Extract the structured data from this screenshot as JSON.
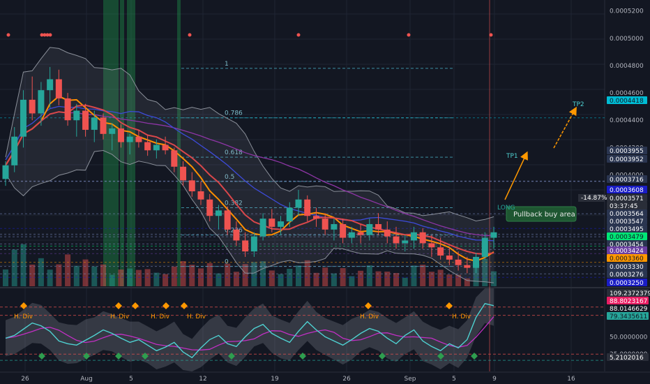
{
  "colors": {
    "background": "#131722",
    "grid": "#1f2433",
    "up": "#26a69a",
    "down": "#ef5350",
    "fib": "#4fc3d9",
    "fib_label": "#7fbfcc",
    "text": "#b2b5be",
    "ema_orange": "#ff8f00",
    "ema_red": "#d9474b",
    "ma_blue": "#3d4bd9",
    "ma_purple": "#8e35a6",
    "bollinger": "#8a8f99",
    "arrow": "#ff9800",
    "annotation_fill": "#1e5631",
    "annotation_text": "#e8e8e8",
    "green_band": "#1fa84f",
    "rsi_line": "#4fd1d1",
    "rsi_signal": "#c22fc4"
  },
  "chart_data": [
    {
      "type": "candlestick",
      "title": "",
      "ylim": [
        0.000318,
        0.000528
      ],
      "y_ticks": [
        "0.0005200",
        "0.0005000",
        "0.0004800",
        "0.0004600",
        "0.0004400",
        "0.0004200",
        "0.0004000"
      ],
      "x_ticks": [
        "26",
        "Aug",
        "5",
        "12",
        "19",
        "26",
        "Sep",
        "5",
        "9",
        "16"
      ],
      "price_tags": [
        {
          "value": "0.0004418",
          "color": "#00bcd4",
          "text_color": "#131722"
        },
        {
          "value": "0.0003955",
          "color": "#2a3550",
          "text_color": "#ffffff"
        },
        {
          "value": "0.0003952",
          "color": "#2a3550",
          "text_color": "#ffffff"
        },
        {
          "value": "0.0003716",
          "color": "#2a3550",
          "text_color": "#ffffff"
        },
        {
          "value": "0.0003608",
          "color": "#1a1dc6",
          "text_color": "#ffffff"
        },
        {
          "value": "0.0003571",
          "color": "#2a2e39",
          "text_color": "#ffffff"
        },
        {
          "value": "03:37:45",
          "color": "#2a2e39",
          "text_color": "#ffffff"
        },
        {
          "value": "0.0003564",
          "color": "#2a3550",
          "text_color": "#ffffff"
        },
        {
          "value": "0.0003547",
          "color": "#2a3550",
          "text_color": "#ffffff"
        },
        {
          "value": "0.0003495",
          "color": "#2a3550",
          "text_color": "#ffffff"
        },
        {
          "value": "0.0003479",
          "color": "#00e676",
          "text_color": "#131722"
        },
        {
          "value": "0.0003454",
          "color": "#2a3550",
          "text_color": "#ffffff"
        },
        {
          "value": "0.0003424",
          "color": "#6a3ea1",
          "text_color": "#ffffff"
        },
        {
          "value": "0.0003360",
          "color": "#ff9800",
          "text_color": "#131722"
        },
        {
          "value": "0.0003330",
          "color": "#2a3550",
          "text_color": "#ffffff"
        },
        {
          "value": "0.0003276",
          "color": "#2a3550",
          "text_color": "#ffffff"
        },
        {
          "value": "0.0003250",
          "color": "#1a1dc6",
          "text_color": "#ffffff"
        }
      ],
      "change_badge": "-14.87%",
      "fib_levels": [
        {
          "label": "1",
          "value": 0.000478
        },
        {
          "label": "0.786",
          "value": 0.0004418
        },
        {
          "label": "0.618",
          "value": 0.000413
        },
        {
          "label": "0.5",
          "value": 0.0003952
        },
        {
          "label": "0.382",
          "value": 0.000376
        },
        {
          "label": "0.236",
          "value": 0.000356
        },
        {
          "label": "0",
          "value": 0.000333
        }
      ],
      "annotations": {
        "tp1": "TP1",
        "tp2": "TP2",
        "pullback": "Pullback buy area",
        "long": "LONG"
      },
      "candles": [
        [
          0.000397,
          0.00041,
          0.000392,
          0.000407
        ],
        [
          0.000407,
          0.000435,
          0.000402,
          0.000428
        ],
        [
          0.000428,
          0.000462,
          0.00042,
          0.000455
        ],
        [
          0.000455,
          0.000472,
          0.00044,
          0.000445
        ],
        [
          0.000445,
          0.000468,
          0.000436,
          0.000462
        ],
        [
          0.000462,
          0.000479,
          0.000449,
          0.00047
        ],
        [
          0.00047,
          0.000477,
          0.000451,
          0.000456
        ],
        [
          0.000456,
          0.00046,
          0.000436,
          0.00044
        ],
        [
          0.00044,
          0.000452,
          0.000428,
          0.000447
        ],
        [
          0.000447,
          0.000452,
          0.000428,
          0.000433
        ],
        [
          0.000433,
          0.000447,
          0.000424,
          0.000442
        ],
        [
          0.000442,
          0.000445,
          0.000426,
          0.00043
        ],
        [
          0.00043,
          0.000438,
          0.000418,
          0.000434
        ],
        [
          0.000434,
          0.000437,
          0.00042,
          0.000424
        ],
        [
          0.000424,
          0.00043,
          0.000415,
          0.000428
        ],
        [
          0.000428,
          0.000433,
          0.00042,
          0.000424
        ],
        [
          0.000424,
          0.000429,
          0.000414,
          0.000418
        ],
        [
          0.000418,
          0.000426,
          0.000412,
          0.000422
        ],
        [
          0.000422,
          0.000428,
          0.000415,
          0.000418
        ],
        [
          0.000418,
          0.00042,
          0.000402,
          0.000406
        ],
        [
          0.000406,
          0.00041,
          0.000392,
          0.000396
        ],
        [
          0.000396,
          0.000402,
          0.000384,
          0.000388
        ],
        [
          0.000388,
          0.000395,
          0.000378,
          0.000382
        ],
        [
          0.000382,
          0.000386,
          0.000366,
          0.00037
        ],
        [
          0.00037,
          0.000378,
          0.00036,
          0.000374
        ],
        [
          0.000374,
          0.000377,
          0.000356,
          0.00036
        ],
        [
          0.00036,
          0.000366,
          0.000348,
          0.000352
        ],
        [
          0.000352,
          0.000358,
          0.00034,
          0.000344
        ],
        [
          0.000344,
          0.000358,
          0.00034,
          0.000355
        ],
        [
          0.000355,
          0.000372,
          0.000352,
          0.000368
        ],
        [
          0.000368,
          0.000375,
          0.000358,
          0.000362
        ],
        [
          0.000362,
          0.00037,
          0.000356,
          0.000366
        ],
        [
          0.000366,
          0.00038,
          0.000362,
          0.000376
        ],
        [
          0.000376,
          0.000389,
          0.00037,
          0.000382
        ],
        [
          0.000382,
          0.000385,
          0.000366,
          0.00037
        ],
        [
          0.00037,
          0.000376,
          0.000362,
          0.000368
        ],
        [
          0.000368,
          0.000372,
          0.000356,
          0.00036
        ],
        [
          0.00036,
          0.000368,
          0.000352,
          0.000364
        ],
        [
          0.000364,
          0.000368,
          0.00035,
          0.000354
        ],
        [
          0.000354,
          0.000362,
          0.00035,
          0.000358
        ],
        [
          0.000358,
          0.000364,
          0.00035,
          0.000356
        ],
        [
          0.000356,
          0.000368,
          0.000352,
          0.000364
        ],
        [
          0.000364,
          0.000372,
          0.000356,
          0.00036
        ],
        [
          0.00036,
          0.000366,
          0.00035,
          0.000355
        ],
        [
          0.000355,
          0.000362,
          0.000346,
          0.00035
        ],
        [
          0.00035,
          0.000356,
          0.000344,
          0.000352
        ],
        [
          0.000352,
          0.000362,
          0.000346,
          0.000358
        ],
        [
          0.000358,
          0.000361,
          0.000346,
          0.00035
        ],
        [
          0.00035,
          0.000356,
          0.00034,
          0.000347
        ],
        [
          0.000347,
          0.000354,
          0.000338,
          0.000341
        ],
        [
          0.000341,
          0.000347,
          0.000334,
          0.000338
        ],
        [
          0.000338,
          0.000344,
          0.00033,
          0.000334
        ],
        [
          0.000334,
          0.00034,
          0.000328,
          0.000332
        ],
        [
          0.000332,
          0.000343,
          0.000328,
          0.00034
        ],
        [
          0.00034,
          0.000358,
          0.000338,
          0.000354
        ],
        [
          0.000354,
          0.000362,
          0.000346,
          0.000358
        ]
      ]
    },
    {
      "type": "line",
      "title": "",
      "ylim": [
        0,
        120
      ],
      "y_ticks": [
        "50.0000000",
        "25.0000000"
      ],
      "value_tags": [
        {
          "value": "109.2372379",
          "color": "#2a2e39",
          "text_color": "#ffffff"
        },
        {
          "value": "88.8023167",
          "color": "#e91e63",
          "text_color": "#ffffff"
        },
        {
          "value": "88.0146629",
          "color": "#131722",
          "text_color": "#ffffff"
        },
        {
          "value": "79.3435611",
          "color": "#26a69a",
          "text_color": "#131722"
        },
        {
          "value": "5.2102016",
          "color": "#2a2e39",
          "text_color": "#ffffff"
        }
      ],
      "divergence_label": "H. Div",
      "series": [
        {
          "values": [
            48,
            52,
            61,
            70,
            66,
            58,
            44,
            40,
            38,
            45,
            52,
            60,
            55,
            48,
            42,
            46,
            38,
            30,
            35,
            42,
            28,
            20,
            34,
            46,
            52,
            40,
            36,
            50,
            62,
            68,
            55,
            48,
            42,
            58,
            72,
            60,
            50,
            44,
            38,
            46,
            55,
            62,
            58,
            48,
            40,
            52,
            60,
            44,
            36,
            30,
            40,
            34,
            46,
            78,
            98,
            95
          ]
        }
      ]
    }
  ]
}
